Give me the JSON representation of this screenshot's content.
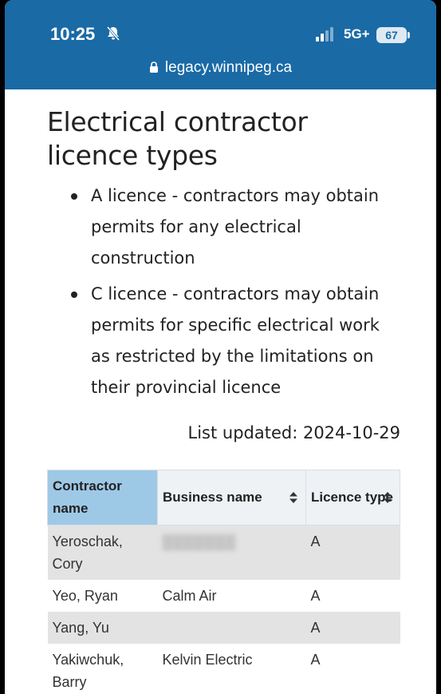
{
  "status_bar": {
    "time": "10:25",
    "network": "5G+",
    "battery": "67",
    "icons": [
      "bell-muted-icon",
      "signal-icon",
      "battery-icon"
    ]
  },
  "browser": {
    "url": "legacy.winnipeg.ca"
  },
  "page": {
    "title": "Electrical contractor licence types",
    "licence_types": [
      "A licence - contractors may obtain permits for any electrical construction",
      "C licence - contractors may obtain permits for specific electrical work as restricted by the limitations on their provincial licence"
    ],
    "list_updated": "List updated: 2024-10-29"
  },
  "table": {
    "headers": {
      "contractor_name": "Contractor name",
      "business_name": "Business name",
      "licence_type": "Licence type"
    },
    "rows": [
      {
        "contractor": "Yeroschak, Cory",
        "business": "",
        "type": "A"
      },
      {
        "contractor": "Yeo, Ryan",
        "business": "Calm Air",
        "type": "A"
      },
      {
        "contractor": "Yang, Yu",
        "business": "",
        "type": "A"
      },
      {
        "contractor": "Yakiwchuk, Barry",
        "business": "Kelvin Electric",
        "type": "A"
      }
    ]
  },
  "colors": {
    "header_bar": "#1a6aa6",
    "sorted_column": "#9ec9e6",
    "row_shade": "#e3e3e3"
  }
}
